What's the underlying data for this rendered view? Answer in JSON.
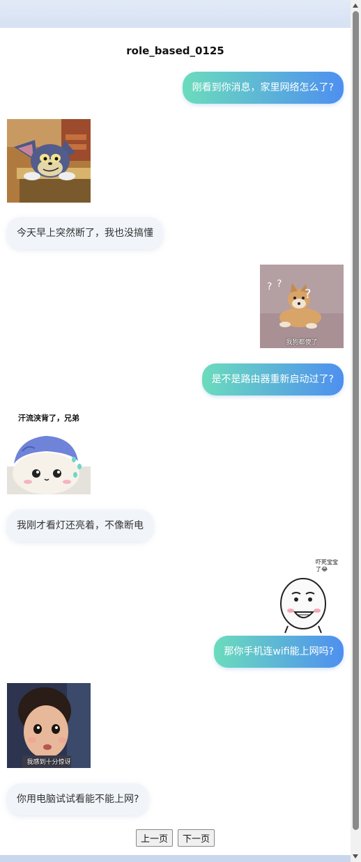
{
  "title": "role_based_0125",
  "messages": [
    {
      "side": "right",
      "text": "刚看到你消息，家里网络怎么了?"
    },
    {
      "side": "left",
      "sticker": "tom-cat-sticker"
    },
    {
      "side": "left",
      "text": "今天早上突然断了，我也没搞懂"
    },
    {
      "side": "right",
      "sticker": "confused-shiba-sticker",
      "caption": "我狗都傻了"
    },
    {
      "side": "right",
      "text": "是不是路由器重新启动过了?"
    },
    {
      "side": "left",
      "sticker": "sweating-chiikawa-sticker",
      "caption": "汗流浃背了，兄弟"
    },
    {
      "side": "left",
      "text": "我刚才看灯还亮着，不像断电"
    },
    {
      "side": "right",
      "sticker": "panda-face-sticker",
      "caption": "吓死宝宝了😂"
    },
    {
      "side": "right",
      "text": "那你手机连wifi能上网吗?"
    },
    {
      "side": "left",
      "sticker": "surprised-kid-sticker",
      "caption": "我感到十分惊讶"
    },
    {
      "side": "left",
      "text": "你用电脑试试看能不能上网?"
    }
  ],
  "pager": {
    "prev": "上一页",
    "next": "下一页"
  },
  "colors": {
    "bubble_right_start": "#6bdcbc",
    "bubble_right_end": "#4e8ff0",
    "bubble_left": "#f1f4f9"
  }
}
